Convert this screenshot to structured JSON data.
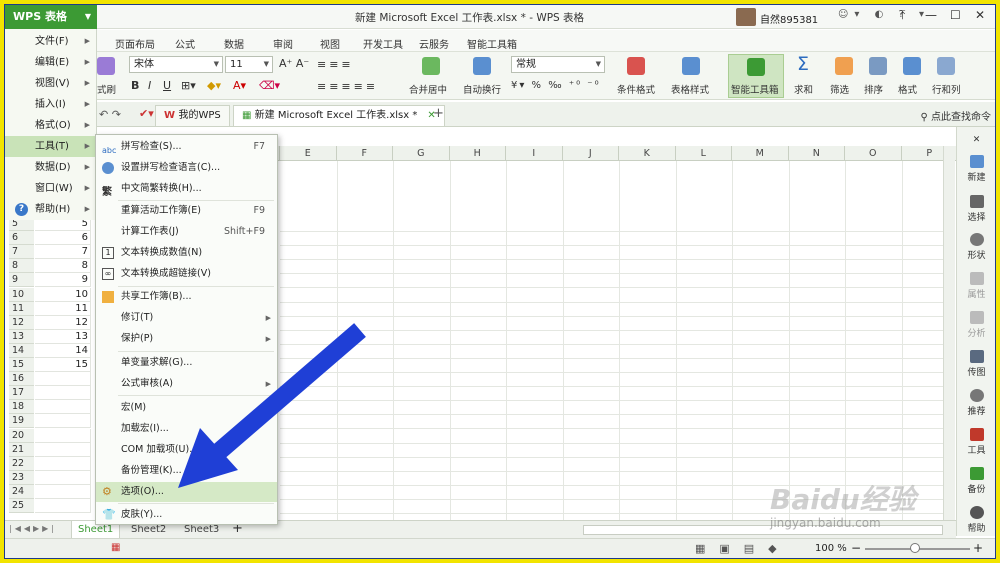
{
  "app": {
    "button_label": "WPS 表格",
    "title": "新建 Microsoft Excel 工作表.xlsx * - WPS 表格",
    "username": "自然895381"
  },
  "menubar": [
    "页面布局",
    "公式",
    "数据",
    "审阅",
    "视图",
    "开发工具",
    "云服务",
    "智能工具箱"
  ],
  "left_menu": [
    {
      "label": "文件(F)"
    },
    {
      "label": "编辑(E)"
    },
    {
      "label": "视图(V)"
    },
    {
      "label": "插入(I)"
    },
    {
      "label": "格式(O)"
    },
    {
      "label": "工具(T)"
    },
    {
      "label": "数据(D)"
    },
    {
      "label": "窗口(W)"
    },
    {
      "label": "帮助(H)"
    }
  ],
  "ribbon": {
    "font_name": "宋体",
    "font_size": "11",
    "number_format": "常规",
    "format_brush": "式刷",
    "merge_center": "合并居中",
    "auto_wrap": "自动换行",
    "cond_format": "条件格式",
    "table_style": "表格样式",
    "smart_toolbox": "智能工具箱",
    "sum": "求和",
    "filter": "筛选",
    "sort": "排序",
    "format": "格式",
    "row_col": "行和列"
  },
  "tabs": {
    "home": "我的WPS",
    "doc": "新建 Microsoft Excel 工作表.xlsx *",
    "search": "点此查找命令"
  },
  "columns": [
    "E",
    "F",
    "G",
    "H",
    "I",
    "J",
    "K",
    "L",
    "M",
    "N",
    "O",
    "P"
  ],
  "rows": [
    {
      "n": "5",
      "a": "5"
    },
    {
      "n": "6",
      "a": "6"
    },
    {
      "n": "7",
      "a": "7"
    },
    {
      "n": "8",
      "a": "8"
    },
    {
      "n": "9",
      "a": "9"
    },
    {
      "n": "10",
      "a": "10"
    },
    {
      "n": "11",
      "a": "11"
    },
    {
      "n": "12",
      "a": "12"
    },
    {
      "n": "13",
      "a": "13"
    },
    {
      "n": "14",
      "a": "14"
    },
    {
      "n": "15",
      "a": "15"
    },
    {
      "n": "16",
      "a": ""
    },
    {
      "n": "17",
      "a": ""
    },
    {
      "n": "18",
      "a": ""
    },
    {
      "n": "19",
      "a": ""
    },
    {
      "n": "20",
      "a": ""
    },
    {
      "n": "21",
      "a": ""
    },
    {
      "n": "22",
      "a": ""
    },
    {
      "n": "23",
      "a": ""
    },
    {
      "n": "24",
      "a": ""
    },
    {
      "n": "25",
      "a": ""
    }
  ],
  "tools_menu": [
    {
      "label": "拼写检查(S)...",
      "shortcut": "F7"
    },
    {
      "label": "设置拼写检查语言(C)...",
      "shortcut": ""
    },
    {
      "label": "中文简繁转换(H)...",
      "shortcut": ""
    },
    {
      "label": "重算活动工作簿(E)",
      "shortcut": "F9"
    },
    {
      "label": "计算工作表(J)",
      "shortcut": "Shift+F9"
    },
    {
      "label": "文本转换成数值(N)",
      "shortcut": ""
    },
    {
      "label": "文本转换成超链接(V)",
      "shortcut": ""
    },
    {
      "label": "共享工作簿(B)...",
      "shortcut": ""
    },
    {
      "label": "修订(T)",
      "shortcut": ""
    },
    {
      "label": "保护(P)",
      "shortcut": ""
    },
    {
      "label": "单变量求解(G)...",
      "shortcut": ""
    },
    {
      "label": "公式审核(A)",
      "shortcut": ""
    },
    {
      "label": "宏(M)",
      "shortcut": ""
    },
    {
      "label": "加载宏(I)...",
      "shortcut": ""
    },
    {
      "label": "COM 加载项(U)...",
      "shortcut": ""
    },
    {
      "label": "备份管理(K)...",
      "shortcut": ""
    },
    {
      "label": "选项(O)...",
      "shortcut": ""
    },
    {
      "label": "皮肤(Y)...",
      "shortcut": ""
    }
  ],
  "right_pane": [
    "新建",
    "选择",
    "形状",
    "属性",
    "分析",
    "传图",
    "推荐",
    "工具",
    "备份",
    "帮助"
  ],
  "sheets": [
    "Sheet1",
    "Sheet2",
    "Sheet3"
  ],
  "status": {
    "zoom": "100 %"
  },
  "watermark": {
    "logo": "Baidu经验",
    "url": "jingyan.baidu.com"
  },
  "colors": {
    "accent": "#3c9a34",
    "arrow": "#1f3fd6",
    "frame": "#f2e400"
  }
}
